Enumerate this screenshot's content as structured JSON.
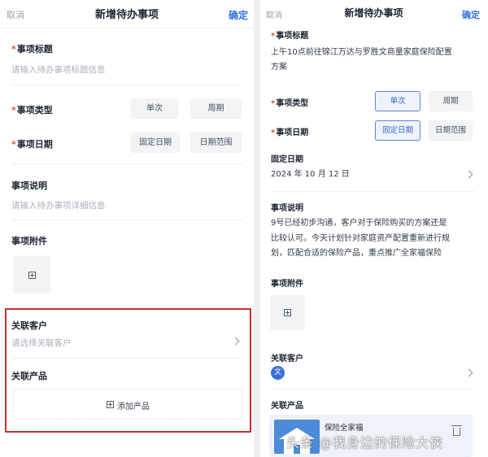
{
  "left": {
    "nav": {
      "cancel": "取消",
      "title": "新增待办事项",
      "confirm": "确定"
    },
    "title_field": {
      "label": "事项标题",
      "placeholder": "请输入待办事项标题信息"
    },
    "type_field": {
      "label": "事项类型",
      "options": [
        "单次",
        "周期"
      ]
    },
    "date_field": {
      "label": "事项日期",
      "options": [
        "固定日期",
        "日期范围"
      ]
    },
    "desc_field": {
      "label": "事项说明",
      "placeholder": "请输入待办事项详细信息"
    },
    "attach_field": {
      "label": "事项附件"
    },
    "customer_field": {
      "label": "关联客户",
      "placeholder": "请选择关联客户"
    },
    "product_field": {
      "label": "关联产品",
      "add_button": "添加产品"
    },
    "required_mark": "*"
  },
  "right": {
    "nav": {
      "cancel": "取消",
      "title": "新增待办事项",
      "confirm": "确定"
    },
    "title_field": {
      "label": "事项标题",
      "value_line1": "上午10点前往锦江万达与罗胜文商量家庭保险配置",
      "value_line2": "方案"
    },
    "type_field": {
      "label": "事项类型",
      "options": [
        "单次",
        "周期"
      ],
      "selected": "单次"
    },
    "date_field": {
      "label": "事项日期",
      "options": [
        "固定日期",
        "日期范围"
      ],
      "selected": "固定日期"
    },
    "fixed_date": {
      "label": "固定日期",
      "value": "2024 年 10 月 12 日"
    },
    "desc_field": {
      "label": "事项说明",
      "lines": [
        "9号已经初步沟通，客户对于保险购买的方案还是",
        "比较认可。今天计划针对家庭资产配置重新进行规",
        "划，匹配合适的保险产品，重点推广全家福保险"
      ]
    },
    "attach_field": {
      "label": "事项附件"
    },
    "customer_field": {
      "label": "关联客户",
      "avatar_text": "文"
    },
    "product_field": {
      "label": "关联产品",
      "product_name": "保险全家福"
    },
    "required_mark": "*"
  },
  "watermark": "头条 @我身边的保险大侠",
  "colors": {
    "accent": "#2f6fe0",
    "required": "#e0533c",
    "highlight": "#c9302c"
  }
}
